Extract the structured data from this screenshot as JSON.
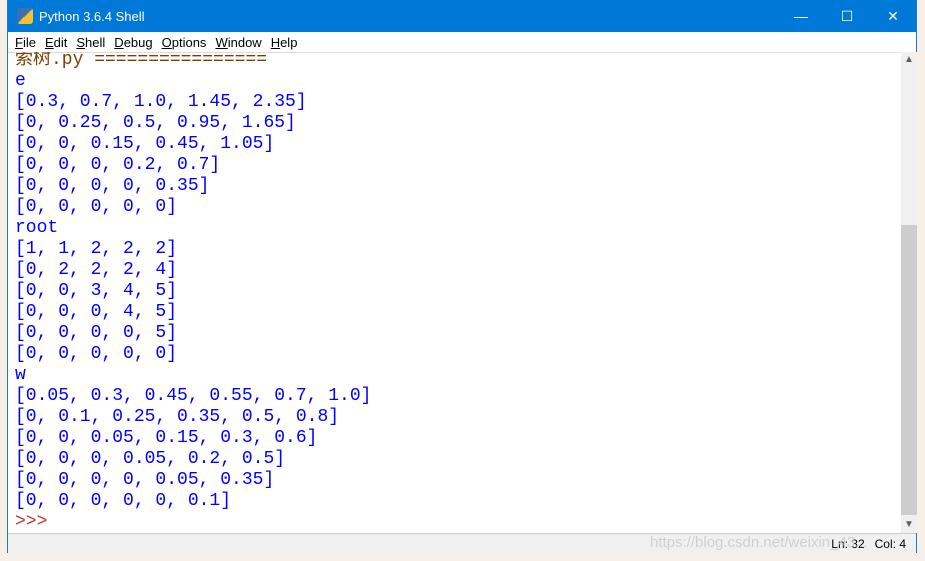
{
  "window": {
    "title": "Python 3.6.4 Shell",
    "minimize": "—",
    "maximize": "☐",
    "close": "✕"
  },
  "menu": [
    "File",
    "Edit",
    "Shell",
    "Debug",
    "Options",
    "Window",
    "Help"
  ],
  "shell": {
    "header": "索树.py ================",
    "lines": [
      "e",
      "[0.3, 0.7, 1.0, 1.45, 2.35]",
      "[0, 0.25, 0.5, 0.95, 1.65]",
      "[0, 0, 0.15, 0.45, 1.05]",
      "[0, 0, 0, 0.2, 0.7]",
      "[0, 0, 0, 0, 0.35]",
      "[0, 0, 0, 0, 0]",
      "root",
      "[1, 1, 2, 2, 2]",
      "[0, 2, 2, 2, 4]",
      "[0, 0, 3, 4, 5]",
      "[0, 0, 0, 4, 5]",
      "[0, 0, 0, 0, 5]",
      "[0, 0, 0, 0, 0]",
      "w",
      "[0.05, 0.3, 0.45, 0.55, 0.7, 1.0]",
      "[0, 0.1, 0.25, 0.35, 0.5, 0.8]",
      "[0, 0, 0.05, 0.15, 0.3, 0.6]",
      "[0, 0, 0, 0.05, 0.2, 0.5]",
      "[0, 0, 0, 0, 0.05, 0.35]",
      "[0, 0, 0, 0, 0, 0.1]"
    ],
    "prompt": ">>>"
  },
  "status": {
    "ln": "Ln: 32",
    "col": "Col: 4"
  },
  "watermark": "https://blog.csdn.net/weixin_43..."
}
